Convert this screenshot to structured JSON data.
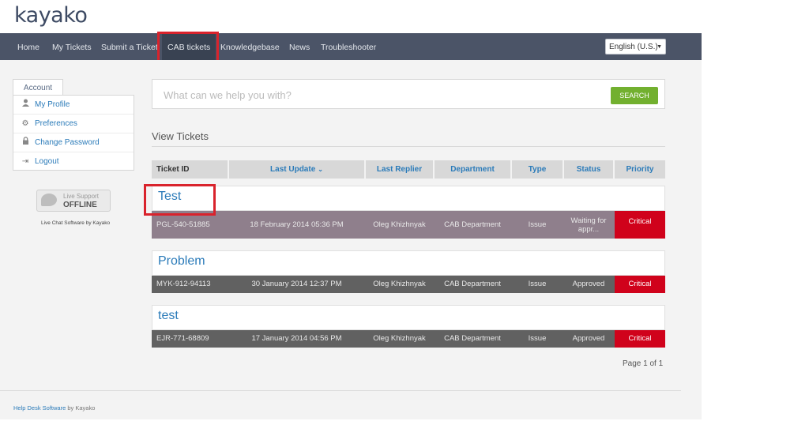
{
  "brand": {
    "logo_text": "kayako"
  },
  "nav": {
    "items": [
      {
        "label": "Home"
      },
      {
        "label": "My Tickets"
      },
      {
        "label": "Submit a Ticket"
      },
      {
        "label": "CAB tickets"
      },
      {
        "label": "Knowledgebase"
      },
      {
        "label": "News"
      },
      {
        "label": "Troubleshooter"
      }
    ],
    "active_index": 3,
    "language": "English (U.S.)"
  },
  "sidebar": {
    "tab_label": "Account",
    "items": [
      {
        "label": "My Profile",
        "icon": "user-icon"
      },
      {
        "label": "Preferences",
        "icon": "gear-icon"
      },
      {
        "label": "Change Password",
        "icon": "lock-icon"
      },
      {
        "label": "Logout",
        "icon": "logout-icon"
      }
    ],
    "live_support": {
      "line1": "Live Support",
      "line2": "OFFLINE",
      "caption": "Live Chat Software by Kayako"
    }
  },
  "search": {
    "placeholder": "What can we help you with?",
    "button_label": "SEARCH"
  },
  "tickets": {
    "section_title": "View Tickets",
    "columns": [
      "Ticket ID",
      "Last Update",
      "Last Replier",
      "Department",
      "Type",
      "Status",
      "Priority"
    ],
    "sort_caret": "⌄",
    "rows": [
      {
        "title": "Test",
        "id": "PGL-540-51885",
        "last_update": "18 February 2014 05:36 PM",
        "last_replier": "Oleg Khizhnyak",
        "department": "CAB Department",
        "type": "Issue",
        "status": "Waiting for appr...",
        "priority": "Critical",
        "row_color": "#8f7f8c"
      },
      {
        "title": "Problem",
        "id": "MYK-912-94113",
        "last_update": "30 January 2014 12:37 PM",
        "last_replier": "Oleg Khizhnyak",
        "department": "CAB Department",
        "type": "Issue",
        "status": "Approved",
        "priority": "Critical",
        "row_color": "#616161"
      },
      {
        "title": "test",
        "id": "EJR-771-68809",
        "last_update": "17 January 2014 04:56 PM",
        "last_replier": "Oleg Khizhnyak",
        "department": "CAB Department",
        "type": "Issue",
        "status": "Approved",
        "priority": "Critical",
        "row_color": "#616161"
      }
    ],
    "pager": "Page 1 of 1"
  },
  "footer": {
    "link_text": "Help Desk Software",
    "suffix": "by Kayako"
  },
  "colors": {
    "navbar": "#4b5467",
    "accent_link": "#2b7bb9",
    "search_button": "#72b02f",
    "critical": "#d0021b",
    "highlight_outline": "#d9232c"
  }
}
